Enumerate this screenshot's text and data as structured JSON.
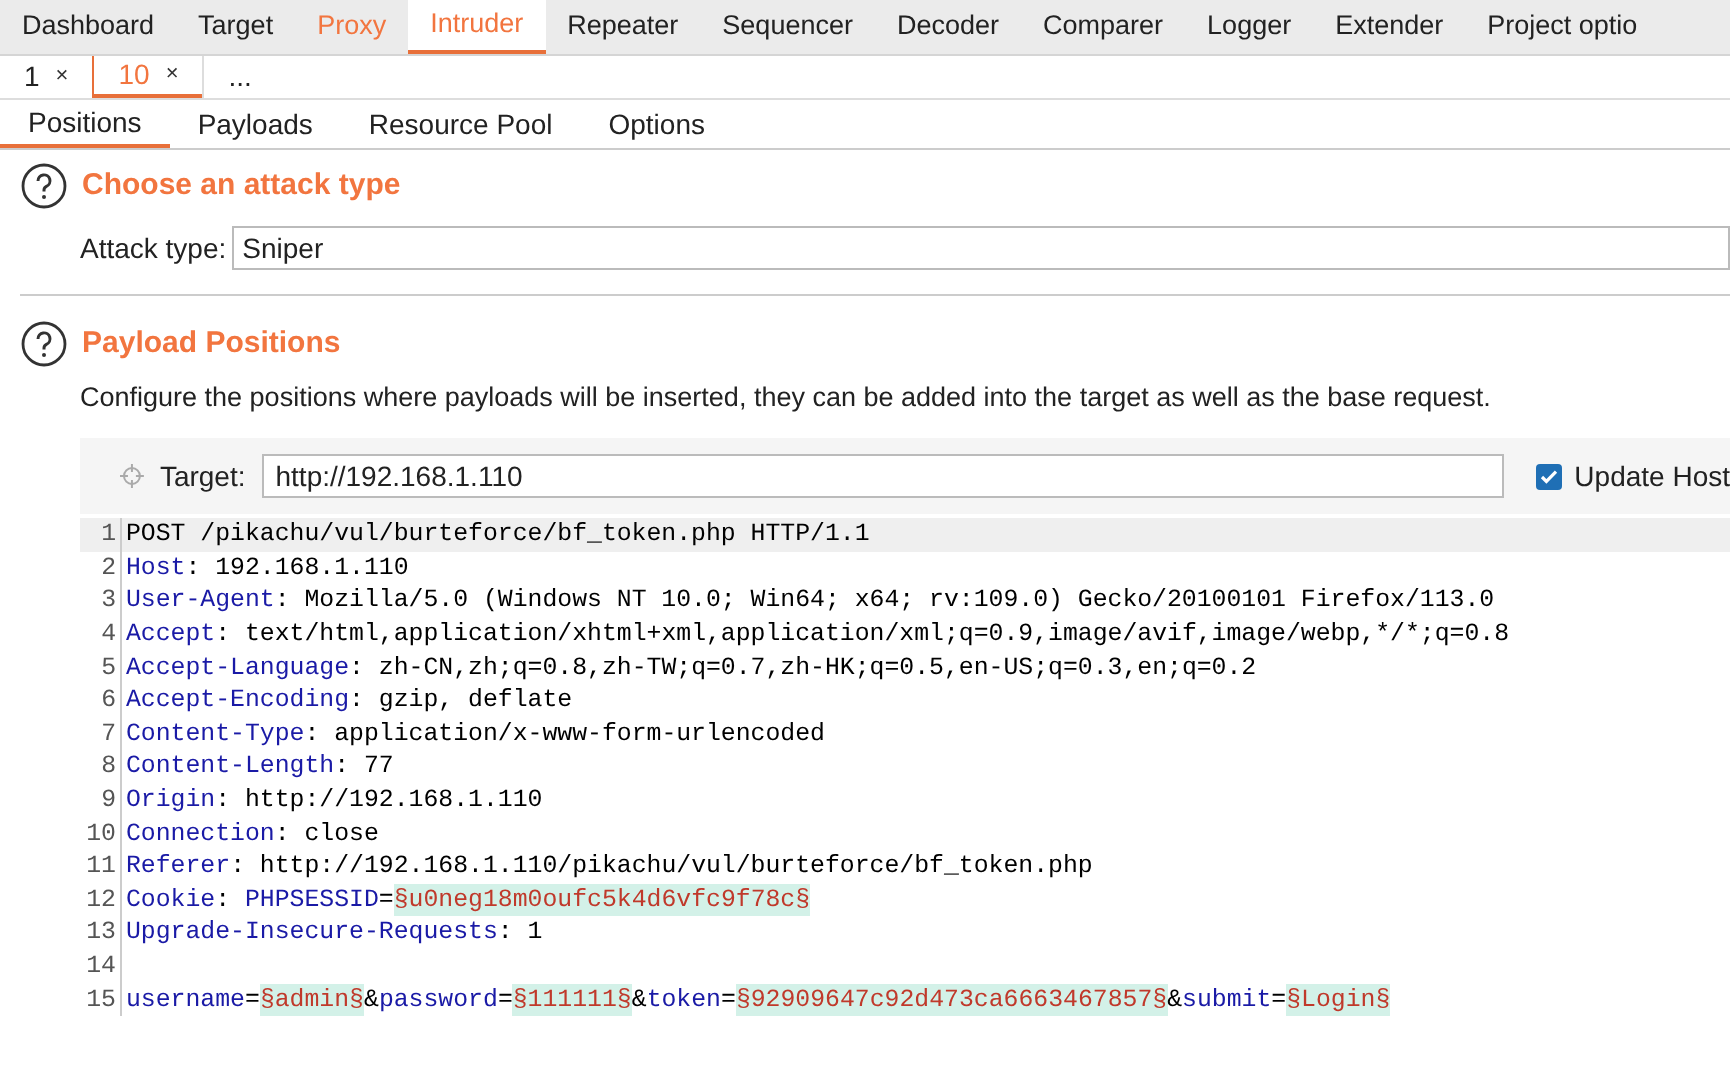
{
  "main_tabs": [
    {
      "label": "Dashboard",
      "selected": false,
      "highlighted": false
    },
    {
      "label": "Target",
      "selected": false,
      "highlighted": false
    },
    {
      "label": "Proxy",
      "selected": false,
      "highlighted": true
    },
    {
      "label": "Intruder",
      "selected": true,
      "highlighted": true
    },
    {
      "label": "Repeater",
      "selected": false,
      "highlighted": false
    },
    {
      "label": "Sequencer",
      "selected": false,
      "highlighted": false
    },
    {
      "label": "Decoder",
      "selected": false,
      "highlighted": false
    },
    {
      "label": "Comparer",
      "selected": false,
      "highlighted": false
    },
    {
      "label": "Logger",
      "selected": false,
      "highlighted": false
    },
    {
      "label": "Extender",
      "selected": false,
      "highlighted": false
    },
    {
      "label": "Project optio",
      "selected": false,
      "highlighted": false
    }
  ],
  "attack_tabs": [
    {
      "label": "1",
      "close": "×",
      "selected": false
    },
    {
      "label": "10",
      "close": "×",
      "selected": true
    },
    {
      "label": "...",
      "selected": false
    }
  ],
  "sub_tabs": [
    {
      "label": "Positions",
      "selected": true
    },
    {
      "label": "Payloads",
      "selected": false
    },
    {
      "label": "Resource Pool",
      "selected": false
    },
    {
      "label": "Options",
      "selected": false
    }
  ],
  "attack_type_section": {
    "heading": "Choose an attack type",
    "label": "Attack type:",
    "value": "Sniper"
  },
  "positions_section": {
    "heading": "Payload Positions",
    "description": "Configure the positions where payloads will be inserted, they can be added into the target as well as the base request.",
    "target_label": "Target:",
    "target_value": "http://192.168.1.110",
    "update_host": {
      "label": "Update Host",
      "checked": true
    }
  },
  "request_lines": [
    {
      "number": "1",
      "current": true,
      "segments": [
        {
          "kind": "text",
          "text": "POST /pikachu/vul/burteforce/bf_token.php HTTP/1.1"
        }
      ]
    },
    {
      "number": "2",
      "current": false,
      "segments": [
        {
          "kind": "key",
          "text": "Host"
        },
        {
          "kind": "text",
          "text": ": 192.168.1.110"
        }
      ]
    },
    {
      "number": "3",
      "current": false,
      "segments": [
        {
          "kind": "key",
          "text": "User-Agent"
        },
        {
          "kind": "text",
          "text": ": Mozilla/5.0 (Windows NT 10.0; Win64; x64; rv:109.0) Gecko/20100101 Firefox/113.0"
        }
      ]
    },
    {
      "number": "4",
      "current": false,
      "segments": [
        {
          "kind": "key",
          "text": "Accept"
        },
        {
          "kind": "text",
          "text": ": text/html,application/xhtml+xml,application/xml;q=0.9,image/avif,image/webp,*/*;q=0.8"
        }
      ]
    },
    {
      "number": "5",
      "current": false,
      "segments": [
        {
          "kind": "key",
          "text": "Accept-Language"
        },
        {
          "kind": "text",
          "text": ": zh-CN,zh;q=0.8,zh-TW;q=0.7,zh-HK;q=0.5,en-US;q=0.3,en;q=0.2"
        }
      ]
    },
    {
      "number": "6",
      "current": false,
      "segments": [
        {
          "kind": "key",
          "text": "Accept-Encoding"
        },
        {
          "kind": "text",
          "text": ": gzip, deflate"
        }
      ]
    },
    {
      "number": "7",
      "current": false,
      "segments": [
        {
          "kind": "key",
          "text": "Content-Type"
        },
        {
          "kind": "text",
          "text": ": application/x-www-form-urlencoded"
        }
      ]
    },
    {
      "number": "8",
      "current": false,
      "segments": [
        {
          "kind": "key",
          "text": "Content-Length"
        },
        {
          "kind": "text",
          "text": ": 77"
        }
      ]
    },
    {
      "number": "9",
      "current": false,
      "segments": [
        {
          "kind": "key",
          "text": "Origin"
        },
        {
          "kind": "text",
          "text": ": http://192.168.1.110"
        }
      ]
    },
    {
      "number": "10",
      "current": false,
      "segments": [
        {
          "kind": "key",
          "text": "Connection"
        },
        {
          "kind": "text",
          "text": ": close"
        }
      ]
    },
    {
      "number": "11",
      "current": false,
      "segments": [
        {
          "kind": "key",
          "text": "Referer"
        },
        {
          "kind": "text",
          "text": ": http://192.168.1.110/pikachu/vul/burteforce/bf_token.php"
        }
      ]
    },
    {
      "number": "12",
      "current": false,
      "segments": [
        {
          "kind": "key",
          "text": "Cookie"
        },
        {
          "kind": "text",
          "text": ": "
        },
        {
          "kind": "key",
          "text": "PHPSESSID"
        },
        {
          "kind": "text",
          "text": "="
        },
        {
          "kind": "payload",
          "text": "§u0neg18m0oufc5k4d6vfc9f78c§"
        }
      ]
    },
    {
      "number": "13",
      "current": false,
      "segments": [
        {
          "kind": "key",
          "text": "Upgrade-Insecure-Requests"
        },
        {
          "kind": "text",
          "text": ": 1"
        }
      ]
    },
    {
      "number": "14",
      "current": false
    },
    {
      "number": "15",
      "current": false,
      "segments": [
        {
          "kind": "key",
          "text": "username"
        },
        {
          "kind": "text",
          "text": "="
        },
        {
          "kind": "payload",
          "text": "§admin§"
        },
        {
          "kind": "text",
          "text": "&"
        },
        {
          "kind": "key",
          "text": "password"
        },
        {
          "kind": "text",
          "text": "="
        },
        {
          "kind": "payload",
          "text": "§111111§"
        },
        {
          "kind": "text",
          "text": "&"
        },
        {
          "kind": "key",
          "text": "token"
        },
        {
          "kind": "text",
          "text": "="
        },
        {
          "kind": "payload",
          "text": "§92909647c92d473ca6663467857§"
        },
        {
          "kind": "text",
          "text": "&"
        },
        {
          "kind": "key",
          "text": "submit"
        },
        {
          "kind": "text",
          "text": "="
        },
        {
          "kind": "payload",
          "text": "§Login§"
        }
      ]
    }
  ]
}
